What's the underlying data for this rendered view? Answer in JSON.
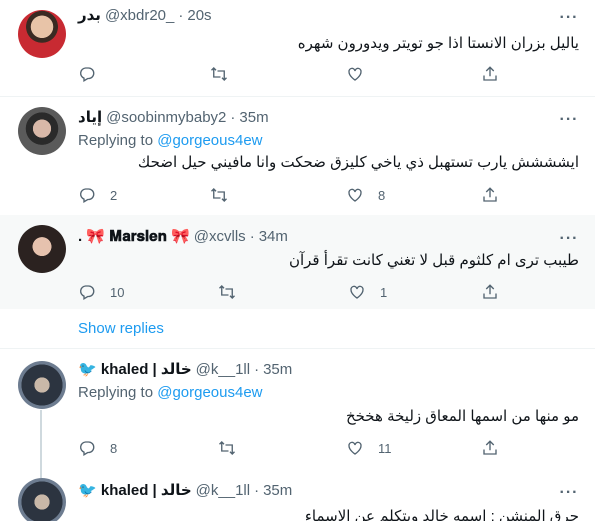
{
  "tweets": [
    {
      "name": "بدر",
      "handle": "@xbdr20_",
      "time": "20s",
      "text": "ياليل بزران الانستا اذا جو تويتر ويدورون شهره",
      "replies": "",
      "retweets": "",
      "likes": ""
    },
    {
      "name": "إياد",
      "handle": "@soobinmybaby2",
      "time": "35m",
      "replying_label": "Replying to",
      "replying_to": "@gorgeous4ew",
      "text": "ايشششش يارب تستهبل ذي ياخي كليزق ضحكت وانا مافيني حيل اضحك",
      "replies": "2",
      "retweets": "",
      "likes": "8"
    },
    {
      "name": ". 🎀 𝐌𝐚𝐫𝐬𝐥𝐞𝐧 🎀",
      "handle": "@xcvlls",
      "time": "34m",
      "text": "طيبب ترى ام كلثوم قبل لا تغني كانت تقرأ قرآن",
      "replies": "10",
      "retweets": "",
      "likes": "1"
    },
    {
      "name": "khaled | خالد",
      "handle": "@k__1ll",
      "time": "35m",
      "replying_label": "Replying to",
      "replying_to": "@gorgeous4ew",
      "text": "مو منها من اسمها المعاق زليخة هخخخ",
      "replies": "8",
      "retweets": "",
      "likes": "11"
    },
    {
      "name": "khaled | خالد",
      "handle": "@k__1ll",
      "time": "35m",
      "text": "حرق المنشن : اسمه خالد ويتكلم عن الاسماء"
    }
  ],
  "show_replies_label": "Show replies",
  "dot": "·",
  "more_label": "···",
  "colors": {
    "link": "#1d9bf0",
    "secondary": "#536471",
    "highlight_bg": "#f7f9f9"
  },
  "icons": [
    "reply-icon",
    "retweet-icon",
    "like-icon",
    "share-icon",
    "more-icon",
    "bird-icon"
  ]
}
